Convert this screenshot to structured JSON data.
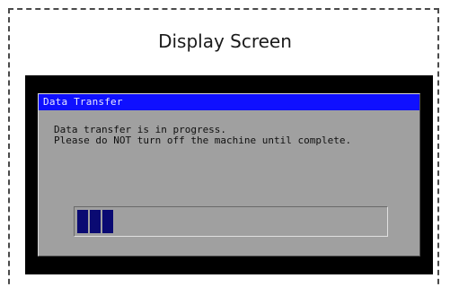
{
  "caption": "Display Screen",
  "dialog": {
    "title": "Data Transfer",
    "message_line1": "Data transfer is in progress.",
    "message_line2": "Please do NOT turn off the machine until complete."
  },
  "progress": {
    "filled_blocks": 3,
    "fraction": 0.12
  },
  "colors": {
    "titlebar": "#0f10ff",
    "dialog_bg": "#a0a0a0",
    "screen_bg": "#000000",
    "progress_block": "#0a0a72"
  }
}
